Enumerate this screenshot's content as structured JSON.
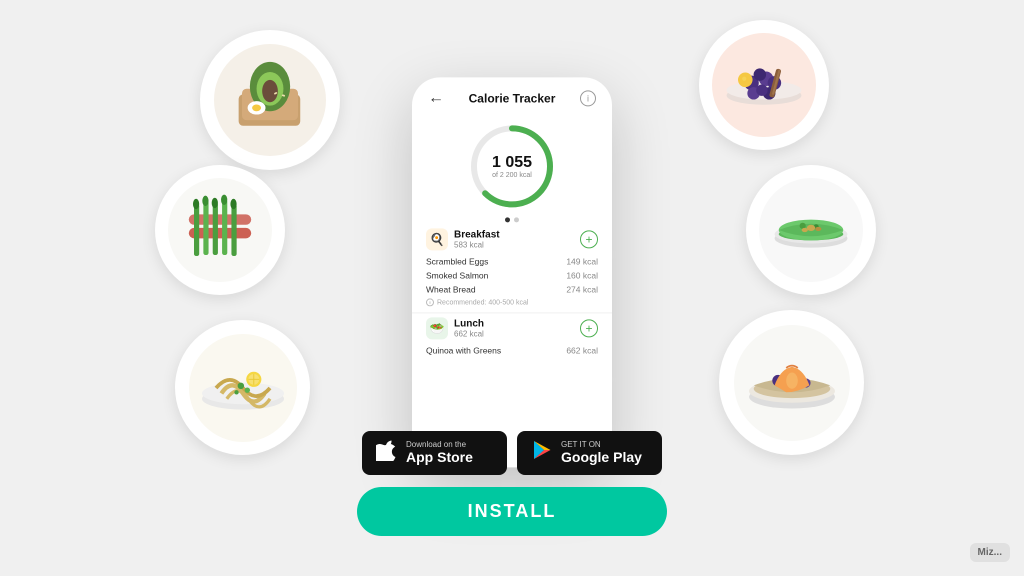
{
  "page": {
    "background_color": "#f0f0f0"
  },
  "food_circles": [
    {
      "id": "toast",
      "emoji": "🥑",
      "label": "avocado-toast"
    },
    {
      "id": "asparagus",
      "emoji": "🥗",
      "label": "asparagus"
    },
    {
      "id": "pasta",
      "emoji": "🍝",
      "label": "pasta"
    },
    {
      "id": "berries",
      "emoji": "🫐",
      "label": "berries"
    },
    {
      "id": "soup",
      "emoji": "🍵",
      "label": "green-soup"
    },
    {
      "id": "oatmeal",
      "emoji": "🍑",
      "label": "oatmeal"
    }
  ],
  "phone": {
    "title": "Calorie Tracker",
    "back_icon": "←",
    "info_icon": "i",
    "calories": "1 055",
    "calories_total": "of 2 200 kcal",
    "dot_active": 0,
    "dot_count": 2,
    "breakfast": {
      "name": "Breakfast",
      "kcal": "583 kcal",
      "emoji": "🍳",
      "items": [
        {
          "name": "Scrambled Eggs",
          "kcal": "149 kcal"
        },
        {
          "name": "Smoked Salmon",
          "kcal": "160 kcal"
        },
        {
          "name": "Wheat Bread",
          "kcal": "274 kcal"
        }
      ],
      "recommendation": "Recommended: 400-500 kcal"
    },
    "lunch": {
      "name": "Lunch",
      "kcal": "662 kcal",
      "emoji": "🥗",
      "items": [
        {
          "name": "Quinoa with Greens",
          "kcal": "662 kcal"
        }
      ]
    }
  },
  "store_buttons": {
    "appstore": {
      "sub_label": "Download on the",
      "main_label": "App Store",
      "icon": "apple"
    },
    "googleplay": {
      "sub_label": "GET IT ON",
      "main_label": "Google Play",
      "icon": "play"
    }
  },
  "install_button": {
    "label": "INSTALL",
    "color": "#00c8a0"
  },
  "watermark": {
    "label": "Miz..."
  }
}
